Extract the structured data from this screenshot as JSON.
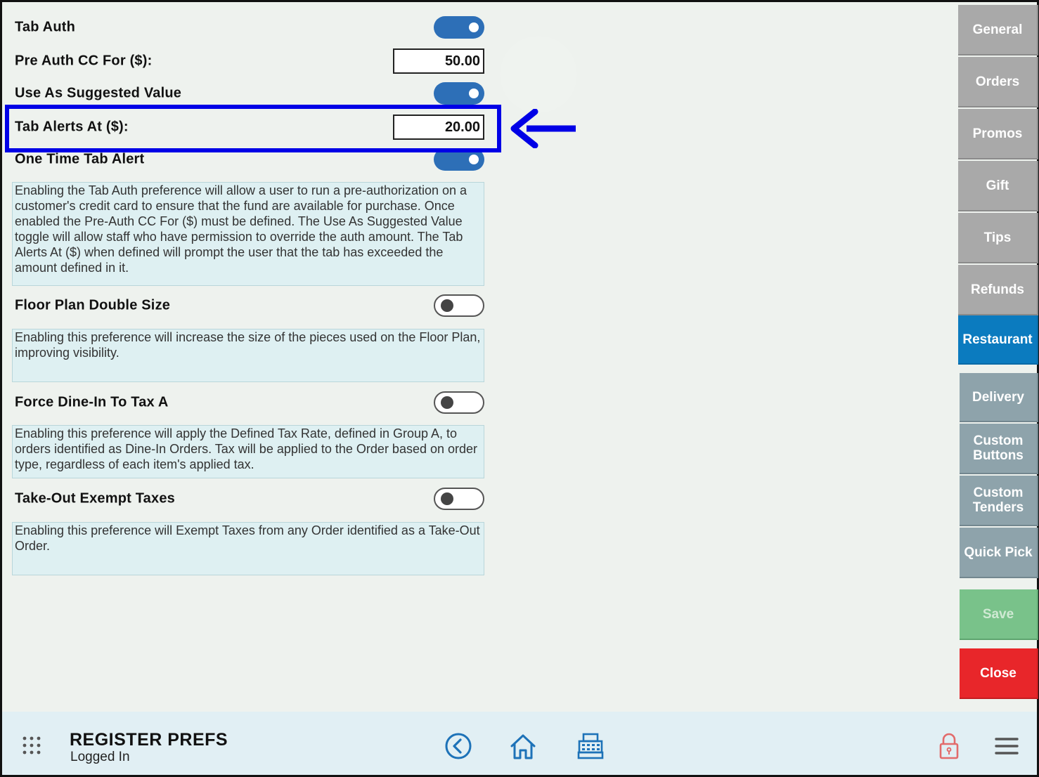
{
  "settings": {
    "tab_auth": {
      "label": "Tab Auth",
      "on": true
    },
    "pre_auth": {
      "label": "Pre Auth CC For ($):",
      "value": "50.00"
    },
    "suggested": {
      "label": "Use As Suggested Value",
      "on": true
    },
    "tab_alerts": {
      "label": "Tab Alerts At ($):",
      "value": "20.00"
    },
    "one_time_alert": {
      "label": "One Time Tab Alert",
      "on": true
    },
    "tab_desc": "Enabling the Tab Auth preference will allow a user to run a pre-authorization on a customer's credit card to ensure that the fund are available for purchase. Once enabled the Pre-Auth CC For ($) must be defined. The Use As Suggested Value toggle will allow staff who have permission to override the auth amount. The Tab Alerts At ($) when defined will prompt the user that the tab has exceeded the amount defined in it.",
    "floor_plan": {
      "label": "Floor Plan Double Size",
      "on": false,
      "desc": "Enabling this preference will increase the size of the pieces used on the Floor Plan, improving visibility."
    },
    "force_dine_in": {
      "label": "Force Dine-In To Tax A",
      "on": false,
      "desc": "Enabling this preference will apply the Defined Tax Rate, defined in Group A, to orders identified as Dine-In Orders. Tax will be applied to the Order based on order type, regardless of each item's applied tax."
    },
    "take_out": {
      "label": "Take-Out Exempt Taxes",
      "on": false,
      "desc": "Enabling this preference will Exempt Taxes from any Order identified as a Take-Out Order."
    }
  },
  "sidebar": {
    "general": "General",
    "orders": "Orders",
    "promos": "Promos",
    "gift": "Gift",
    "tips": "Tips",
    "refunds": "Refunds",
    "restaurant": "Restaurant",
    "delivery": "Delivery",
    "custom_buttons": "Custom Buttons",
    "custom_tenders": "Custom Tenders",
    "quick_pick": "Quick Pick",
    "save": "Save",
    "close": "Close",
    "active": "Restaurant"
  },
  "bottom_bar": {
    "title": "REGISTER PREFS",
    "status": "Logged In",
    "icons": [
      "apps-grid-icon",
      "back-icon",
      "home-icon",
      "register-icon",
      "lock-icon",
      "menu-icon"
    ]
  },
  "colors": {
    "toggle_on": "#2d6fb7",
    "highlight": "#0000e6",
    "active_tab": "#0b7bbf",
    "save": "#79c28a",
    "close": "#e8262a"
  }
}
